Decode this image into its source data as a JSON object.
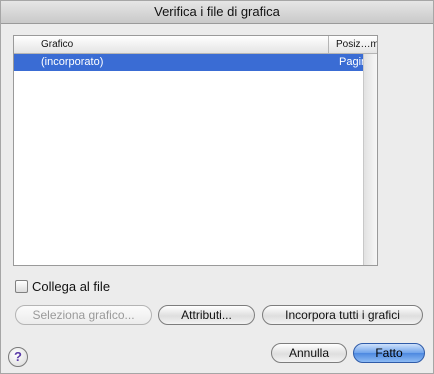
{
  "window": {
    "title": "Verifica i file di grafica"
  },
  "table": {
    "columns": [
      "Grafico",
      "Posiz…me"
    ],
    "rows": [
      {
        "grafico": "(incorporato)",
        "posizione": "Pagina"
      }
    ]
  },
  "options": {
    "link_label": "Collega al file",
    "link_checked": false
  },
  "buttons": {
    "select_graphic": "Seleziona grafico...",
    "attributes": "Attributi...",
    "embed_all": "Incorpora tutti i grafici",
    "cancel": "Annulla",
    "done": "Fatto"
  },
  "help": {
    "glyph": "?",
    "icon": "help-icon"
  }
}
